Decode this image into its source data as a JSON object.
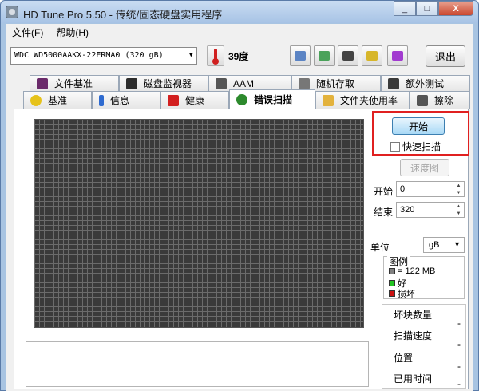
{
  "window": {
    "title": "HD Tune Pro 5.50 - 传统/固态硬盘实用程序",
    "controls": [
      "_",
      "□",
      "X"
    ]
  },
  "menu": [
    "文件(F)",
    "帮助(H)"
  ],
  "toolbar": {
    "drive": "WDC WD5000AAKX-22ERMA0 (320 gB)",
    "temperature": "39度",
    "exit_label": "退出",
    "icons": [
      "copy-info-icon",
      "copy-screen-icon",
      "camera-icon",
      "options-icon",
      "save-down-icon"
    ]
  },
  "tabs": {
    "row1": [
      {
        "label": "文件基准",
        "icon": "file-benchmark-icon"
      },
      {
        "label": "磁盘监视器",
        "icon": "disk-monitor-icon"
      },
      {
        "label": "AAM",
        "icon": "speaker-icon"
      },
      {
        "label": "随机存取",
        "icon": "random-access-icon"
      },
      {
        "label": "额外测试",
        "icon": "extra-tests-icon"
      }
    ],
    "row2": [
      {
        "label": "基准",
        "icon": "benchmark-icon"
      },
      {
        "label": "信息",
        "icon": "info-icon"
      },
      {
        "label": "健康",
        "icon": "health-icon"
      },
      {
        "label": "错误扫描",
        "icon": "search-icon",
        "active": true
      },
      {
        "label": "文件夹使用率",
        "icon": "folder-icon"
      },
      {
        "label": "擦除",
        "icon": "trash-icon"
      }
    ]
  },
  "scan": {
    "start_label": "开始",
    "quick_scan_label": "快速扫描",
    "quick_scan_checked": false,
    "map_label": "速度图",
    "start_field_label": "开始",
    "start_value": "0",
    "end_field_label": "结束",
    "end_value": "320",
    "unit_label": "单位",
    "unit_value": "gB"
  },
  "legend": {
    "title": "图例",
    "block_size": "= 122 MB",
    "good": "好",
    "bad": "损坏",
    "colors": {
      "block": "#808080",
      "good": "#22c422",
      "bad": "#cc1111"
    }
  },
  "stats": {
    "bad_blocks_label": "坏块数量",
    "bad_blocks_value": "-",
    "speed_label": "扫描速度",
    "speed_value": "-",
    "position_label": "位置",
    "position_value": "-",
    "elapsed_label": "已用时间",
    "elapsed_value": "-"
  }
}
